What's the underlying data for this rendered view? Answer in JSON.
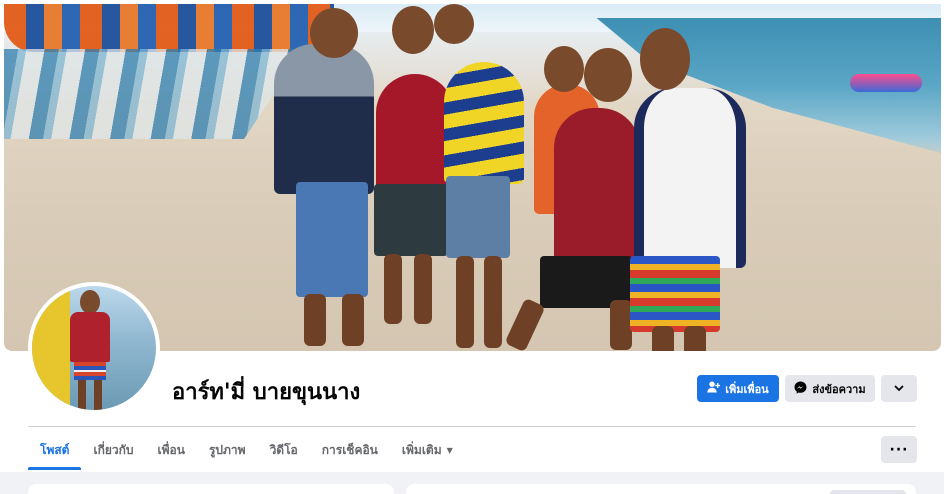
{
  "profile": {
    "name": "อาร์ท'มี่ บายขุนนาง"
  },
  "actions": {
    "add_friend_label": "เพิ่มเพื่อน",
    "message_label": "ส่งข้อความ"
  },
  "tabs": [
    {
      "label": "โพสต์",
      "active": true
    },
    {
      "label": "เกี่ยวกับ",
      "active": false
    },
    {
      "label": "เพื่อน",
      "active": false
    },
    {
      "label": "รูปภาพ",
      "active": false
    },
    {
      "label": "วิดีโอ",
      "active": false
    },
    {
      "label": "การเช็คอิน",
      "active": false
    },
    {
      "label": "เพิ่มเติม",
      "active": false
    }
  ],
  "colors": {
    "accent": "#1b74e4",
    "secondary_button": "#e4e6eb",
    "feed_background": "#f0f2f5"
  },
  "icons": {
    "add_friend": "person-plus-icon",
    "message": "messenger-icon",
    "dropdown": "chevron-down-icon",
    "more": "ellipsis-icon"
  }
}
